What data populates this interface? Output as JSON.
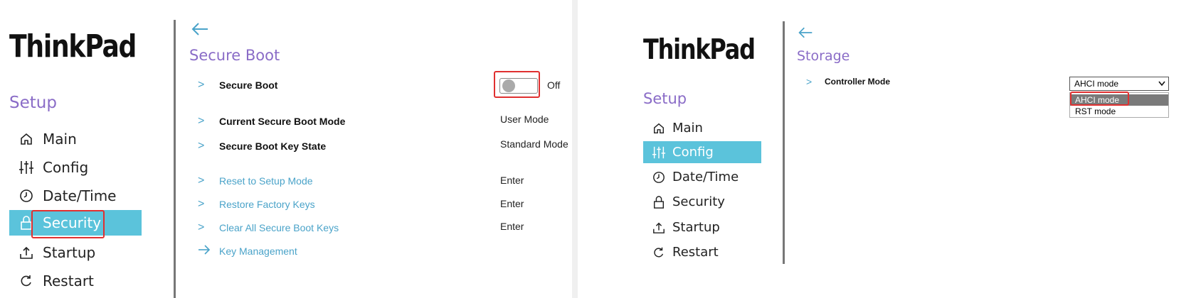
{
  "left": {
    "logo": "ThinkPad",
    "setup_title": "Setup",
    "nav": [
      {
        "label": "Main",
        "icon": "home-icon"
      },
      {
        "label": "Config",
        "icon": "sliders-icon"
      },
      {
        "label": "Date/Time",
        "icon": "clock-icon"
      },
      {
        "label": "Security",
        "icon": "lock-icon",
        "active": true
      },
      {
        "label": "Startup",
        "icon": "upload-icon"
      },
      {
        "label": "Restart",
        "icon": "restart-icon"
      }
    ],
    "page_title": "Secure Boot",
    "rows": [
      {
        "label": "Secure Boot",
        "value": "Off"
      },
      {
        "label": "Current Secure Boot Mode",
        "value": "User Mode"
      },
      {
        "label": "Secure Boot Key State",
        "value": "Standard Mode"
      },
      {
        "label": "Reset to Setup Mode",
        "value": "Enter"
      },
      {
        "label": "Restore Factory Keys",
        "value": "Enter"
      },
      {
        "label": "Clear All Secure Boot Keys",
        "value": "Enter"
      },
      {
        "label": "Key Management",
        "value": ""
      }
    ]
  },
  "right": {
    "logo": "ThinkPad",
    "setup_title": "Setup",
    "nav": [
      {
        "label": "Main",
        "icon": "home-icon"
      },
      {
        "label": "Config",
        "icon": "sliders-icon",
        "active": true
      },
      {
        "label": "Date/Time",
        "icon": "clock-icon"
      },
      {
        "label": "Security",
        "icon": "lock-icon"
      },
      {
        "label": "Startup",
        "icon": "upload-icon"
      },
      {
        "label": "Restart",
        "icon": "restart-icon"
      }
    ],
    "page_title": "Storage",
    "rows": [
      {
        "label": "Controller Mode"
      }
    ],
    "select_value": "AHCI mode",
    "options": [
      "AHCI mode",
      "RST mode"
    ]
  },
  "colors": {
    "accent": "#5bc3db",
    "title": "#8a6cc7",
    "link": "#4aa3c9",
    "highlight": "#e03030"
  }
}
